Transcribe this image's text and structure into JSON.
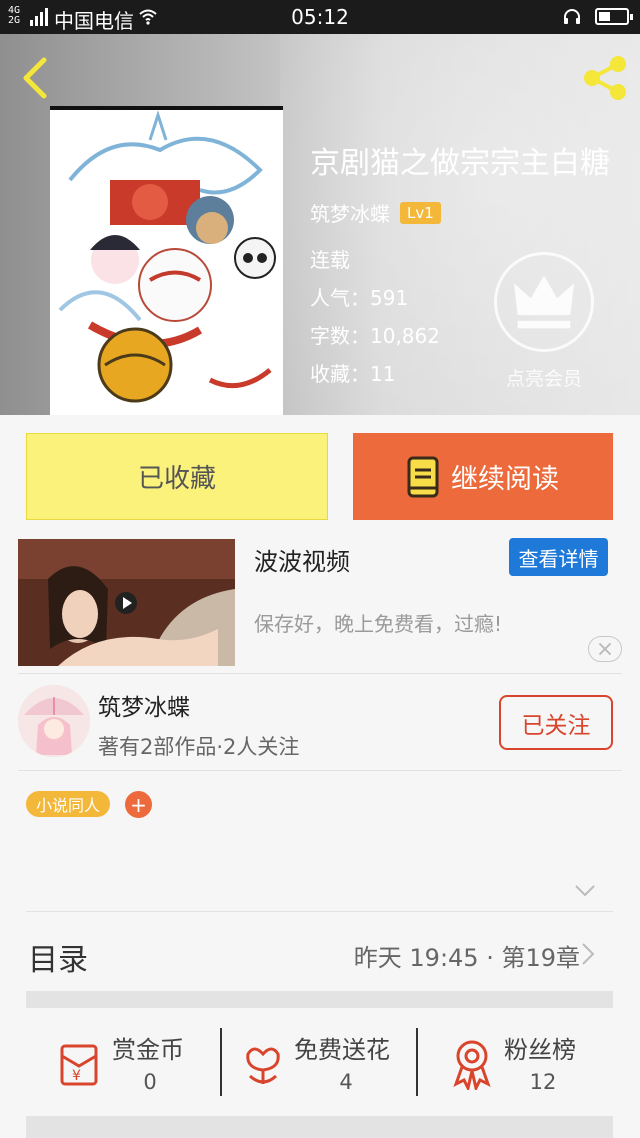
{
  "status_bar": {
    "signal_top": "4G",
    "signal_bottom": "2G",
    "carrier": "中国电信",
    "time": "05:12"
  },
  "book": {
    "title": "京剧猫之做宗宗主白糖",
    "author": "筑梦冰蝶",
    "level": "Lv1",
    "status": "连载",
    "popularity": "人气：591",
    "word_count": "字数：10,862",
    "favorites": "收藏：11"
  },
  "vip": {
    "label": "点亮会员"
  },
  "actions": {
    "favorited_label": "已收藏",
    "continue_label": "继续阅读"
  },
  "ad": {
    "title": "波波视频",
    "button": "查看详情",
    "description": "保存好，晚上免费看，过瘾!"
  },
  "author_card": {
    "name": "筑梦冰蝶",
    "summary": "著有2部作品·2人关注",
    "follow_label": "已关注"
  },
  "tags": [
    "小说同人"
  ],
  "tag_add": "+",
  "toc": {
    "label": "目录",
    "update": "昨天 19:45 · 第19章"
  },
  "stats": [
    {
      "label": "赏金币",
      "value": "0",
      "icon": "red-envelope-yen-icon"
    },
    {
      "label": "免费送花",
      "value": "4",
      "icon": "flower-icon"
    },
    {
      "label": "粉丝榜",
      "value": "12",
      "icon": "ribbon-medal-icon"
    }
  ],
  "colors": {
    "accent_orange": "#ec6a3b",
    "favorite_yellow": "#fbf27c",
    "follow_red": "#d9452c",
    "ad_blue": "#1f79d8",
    "tag_yellow": "#f3b73a"
  }
}
